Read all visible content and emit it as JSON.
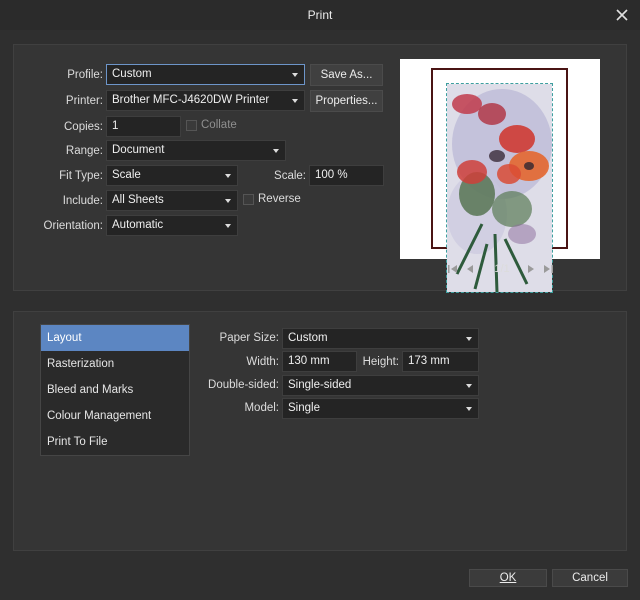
{
  "window": {
    "title": "Print"
  },
  "settings": {
    "profile": {
      "label": "Profile:",
      "value": "Custom"
    },
    "save_as_label": "Save As...",
    "printer": {
      "label": "Printer:",
      "value": "Brother MFC-J4620DW Printer"
    },
    "properties_label": "Properties...",
    "copies": {
      "label": "Copies:",
      "value": "1"
    },
    "collate": {
      "label": "Collate",
      "checked": false
    },
    "range": {
      "label": "Range:",
      "value": "Document"
    },
    "fit_type": {
      "label": "Fit Type:",
      "value": "Scale"
    },
    "scale": {
      "label": "Scale:",
      "value": "100 %"
    },
    "include": {
      "label": "Include:",
      "value": "All Sheets"
    },
    "reverse": {
      "label": "Reverse",
      "checked": false
    },
    "orientation": {
      "label": "Orientation:",
      "value": "Automatic"
    }
  },
  "preview": {
    "page_indicator": "1/1",
    "nav_icons": [
      "first-page-icon",
      "prev-page-icon",
      "next-page-icon",
      "last-page-icon"
    ],
    "frame_color": "#4a1414",
    "guide_color": "#3d9f9f"
  },
  "sidebar": {
    "items": [
      {
        "label": "Layout",
        "selected": true
      },
      {
        "label": "Rasterization",
        "selected": false
      },
      {
        "label": "Bleed and Marks",
        "selected": false
      },
      {
        "label": "Colour Management",
        "selected": false
      },
      {
        "label": "Print To File",
        "selected": false
      }
    ],
    "selected_color": "#5c86c2"
  },
  "layout": {
    "paper_size": {
      "label": "Paper Size:",
      "value": "Custom"
    },
    "width": {
      "label": "Width:",
      "value": "130 mm"
    },
    "height": {
      "label": "Height:",
      "value": "173 mm"
    },
    "double_sided": {
      "label": "Double-sided:",
      "value": "Single-sided"
    },
    "model": {
      "label": "Model:",
      "value": "Single"
    }
  },
  "footer": {
    "ok_label": "OK",
    "cancel_label": "Cancel"
  }
}
